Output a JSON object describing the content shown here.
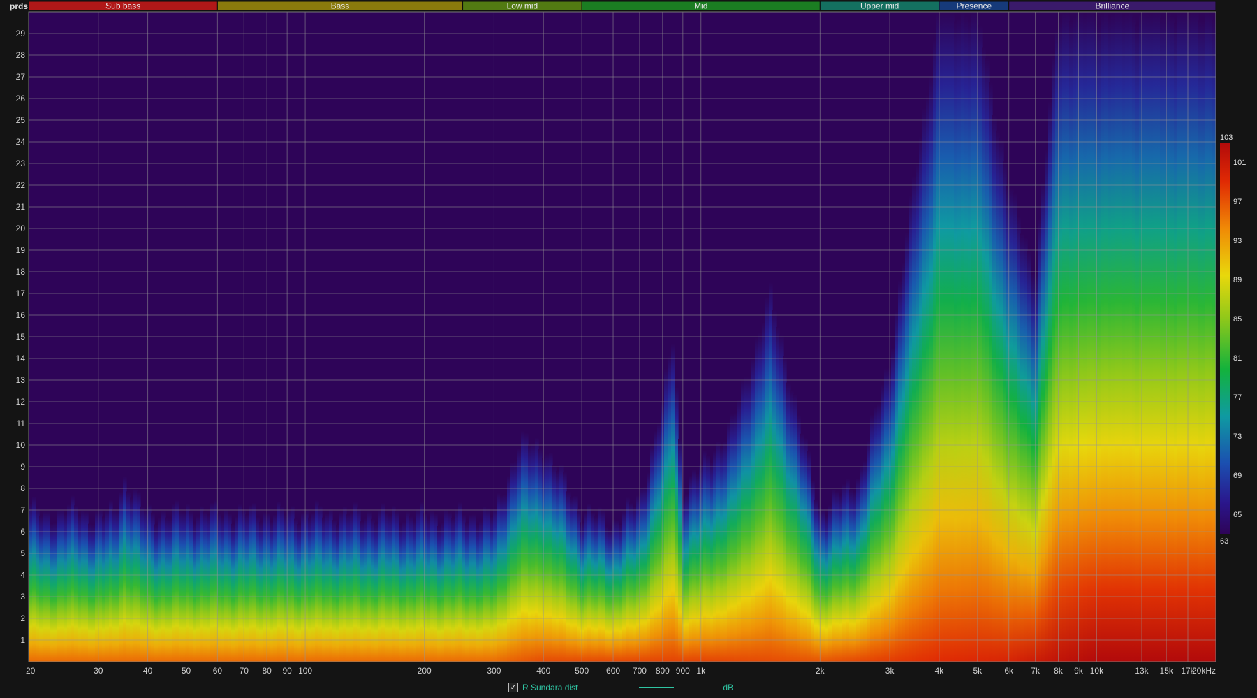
{
  "chart_data": {
    "type": "heatmap",
    "y_unit_label": "prds",
    "x_axis": {
      "scale": "log",
      "range_hz": [
        20,
        20000
      ],
      "ticks": [
        {
          "value": 20,
          "label": "20"
        },
        {
          "value": 30,
          "label": "30"
        },
        {
          "value": 40,
          "label": "40"
        },
        {
          "value": 50,
          "label": "50"
        },
        {
          "value": 60,
          "label": "60"
        },
        {
          "value": 70,
          "label": "70"
        },
        {
          "value": 80,
          "label": "80"
        },
        {
          "value": 90,
          "label": "90"
        },
        {
          "value": 100,
          "label": "100"
        },
        {
          "value": 200,
          "label": "200"
        },
        {
          "value": 300,
          "label": "300"
        },
        {
          "value": 400,
          "label": "400"
        },
        {
          "value": 500,
          "label": "500"
        },
        {
          "value": 600,
          "label": "600"
        },
        {
          "value": 700,
          "label": "700"
        },
        {
          "value": 800,
          "label": "800"
        },
        {
          "value": 900,
          "label": "900"
        },
        {
          "value": 1000,
          "label": "1k"
        },
        {
          "value": 2000,
          "label": "2k"
        },
        {
          "value": 3000,
          "label": "3k"
        },
        {
          "value": 4000,
          "label": "4k"
        },
        {
          "value": 5000,
          "label": "5k"
        },
        {
          "value": 6000,
          "label": "6k"
        },
        {
          "value": 7000,
          "label": "7k"
        },
        {
          "value": 8000,
          "label": "8k"
        },
        {
          "value": 9000,
          "label": "9k"
        },
        {
          "value": 10000,
          "label": "10k"
        },
        {
          "value": 13000,
          "label": "13k"
        },
        {
          "value": 15000,
          "label": "15k"
        },
        {
          "value": 17000,
          "label": "17k"
        },
        {
          "value": 20000,
          "label": "20kHz"
        }
      ]
    },
    "y_axis": {
      "range": [
        0,
        30
      ],
      "ticks": [
        1,
        2,
        3,
        4,
        5,
        6,
        7,
        8,
        9,
        10,
        11,
        12,
        13,
        14,
        15,
        16,
        17,
        18,
        19,
        20,
        21,
        22,
        23,
        24,
        25,
        26,
        27,
        28,
        29
      ]
    },
    "bands": [
      {
        "name": "Sub bass",
        "from": 20,
        "to": 60,
        "color": "#b01818"
      },
      {
        "name": "Bass",
        "from": 60,
        "to": 250,
        "color": "#8a7a0c"
      },
      {
        "name": "Low mid",
        "from": 250,
        "to": 500,
        "color": "#527a12"
      },
      {
        "name": "Mid",
        "from": 500,
        "to": 2000,
        "color": "#1b7d22"
      },
      {
        "name": "Upper mid",
        "from": 2000,
        "to": 4000,
        "color": "#147060"
      },
      {
        "name": "Presence",
        "from": 4000,
        "to": 6000,
        "color": "#163a7a"
      },
      {
        "name": "Brilliance",
        "from": 6000,
        "to": 20000,
        "color": "#3a1a6a"
      }
    ],
    "colorbar": {
      "min": 63,
      "max": 103,
      "labels": [
        103,
        101,
        97,
        93,
        89,
        85,
        81,
        77,
        73,
        69,
        65,
        63
      ]
    },
    "decay_profile": [
      {
        "f": 20,
        "p": 7.4
      },
      {
        "f": 22,
        "p": 6.6
      },
      {
        "f": 25,
        "p": 7.2
      },
      {
        "f": 28,
        "p": 6.8
      },
      {
        "f": 33,
        "p": 6.9
      },
      {
        "f": 35,
        "p": 8.5
      },
      {
        "f": 40,
        "p": 6.8
      },
      {
        "f": 50,
        "p": 7.0
      },
      {
        "f": 70,
        "p": 6.9
      },
      {
        "f": 100,
        "p": 6.9
      },
      {
        "f": 200,
        "p": 6.8
      },
      {
        "f": 300,
        "p": 6.8
      },
      {
        "f": 350,
        "p": 10.2
      },
      {
        "f": 400,
        "p": 10.0
      },
      {
        "f": 500,
        "p": 7.0
      },
      {
        "f": 600,
        "p": 6.5
      },
      {
        "f": 700,
        "p": 7.5
      },
      {
        "f": 800,
        "p": 12.0
      },
      {
        "f": 850,
        "p": 15.0
      },
      {
        "f": 900,
        "p": 8.0
      },
      {
        "f": 1000,
        "p": 9.0
      },
      {
        "f": 1200,
        "p": 11.0
      },
      {
        "f": 1500,
        "p": 17.0
      },
      {
        "f": 2000,
        "p": 7.0
      },
      {
        "f": 2500,
        "p": 8.5
      },
      {
        "f": 3000,
        "p": 14.0
      },
      {
        "f": 3500,
        "p": 23.0
      },
      {
        "f": 4000,
        "p": 30.0
      },
      {
        "f": 5000,
        "p": 30.0
      },
      {
        "f": 6000,
        "p": 22.0
      },
      {
        "f": 7000,
        "p": 18.0
      },
      {
        "f": 8000,
        "p": 30.0
      },
      {
        "f": 20000,
        "p": 30.0
      }
    ],
    "level_profile": [
      {
        "f": 20,
        "l": 0.82
      },
      {
        "f": 300,
        "l": 0.82
      },
      {
        "f": 400,
        "l": 0.86
      },
      {
        "f": 1000,
        "l": 0.87
      },
      {
        "f": 2000,
        "l": 0.85
      },
      {
        "f": 4000,
        "l": 0.9
      },
      {
        "f": 6000,
        "l": 0.92
      },
      {
        "f": 8000,
        "l": 0.97
      },
      {
        "f": 10000,
        "l": 1.0
      },
      {
        "f": 20000,
        "l": 1.0
      }
    ],
    "legend": {
      "checked": true,
      "series_name": "R Sundara dist",
      "unit": "dB"
    }
  }
}
